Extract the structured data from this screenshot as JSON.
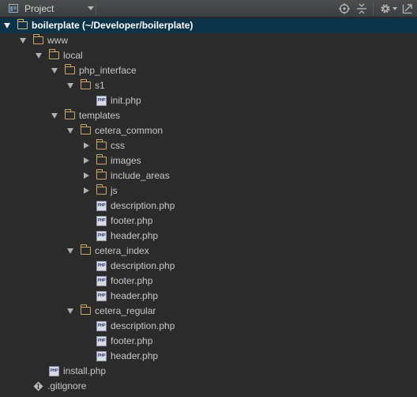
{
  "toolbar": {
    "title": "Project",
    "icons": [
      "project-view-icon",
      "dropdown-icon",
      "locate-icon",
      "collapse-all-icon",
      "gear-icon",
      "hide-icon"
    ]
  },
  "tree": [
    {
      "label": "boilerplate (~/Developer/boilerplate)",
      "type": "folder",
      "depth": 0,
      "expanded": true,
      "selected": true,
      "bold": true
    },
    {
      "label": "www",
      "type": "folder",
      "depth": 1,
      "expanded": true
    },
    {
      "label": "local",
      "type": "folder",
      "depth": 2,
      "expanded": true
    },
    {
      "label": "php_interface",
      "type": "folder",
      "depth": 3,
      "expanded": true
    },
    {
      "label": "s1",
      "type": "folder",
      "depth": 4,
      "expanded": true
    },
    {
      "label": "init.php",
      "type": "php",
      "depth": 5
    },
    {
      "label": "templates",
      "type": "folder",
      "depth": 3,
      "expanded": true
    },
    {
      "label": "cetera_common",
      "type": "folder",
      "depth": 4,
      "expanded": true
    },
    {
      "label": "css",
      "type": "folder",
      "depth": 5,
      "expanded": false
    },
    {
      "label": "images",
      "type": "folder",
      "depth": 5,
      "expanded": false
    },
    {
      "label": "include_areas",
      "type": "folder",
      "depth": 5,
      "expanded": false
    },
    {
      "label": "js",
      "type": "folder",
      "depth": 5,
      "expanded": false
    },
    {
      "label": "description.php",
      "type": "php",
      "depth": 5
    },
    {
      "label": "footer.php",
      "type": "php",
      "depth": 5
    },
    {
      "label": "header.php",
      "type": "php",
      "depth": 5
    },
    {
      "label": "cetera_index",
      "type": "folder",
      "depth": 4,
      "expanded": true
    },
    {
      "label": "description.php",
      "type": "php",
      "depth": 5
    },
    {
      "label": "footer.php",
      "type": "php",
      "depth": 5
    },
    {
      "label": "header.php",
      "type": "php",
      "depth": 5
    },
    {
      "label": "cetera_regular",
      "type": "folder",
      "depth": 4,
      "expanded": true
    },
    {
      "label": "description.php",
      "type": "php",
      "depth": 5
    },
    {
      "label": "footer.php",
      "type": "php",
      "depth": 5
    },
    {
      "label": "header.php",
      "type": "php",
      "depth": 5
    },
    {
      "label": "install.php",
      "type": "php",
      "depth": 2
    },
    {
      "label": ".gitignore",
      "type": "gitignore",
      "depth": 1
    }
  ],
  "colors": {
    "background": "#2b2b2b",
    "selection": "#0d3349",
    "folder": "#c9a86a",
    "text": "#c8c8c8"
  }
}
